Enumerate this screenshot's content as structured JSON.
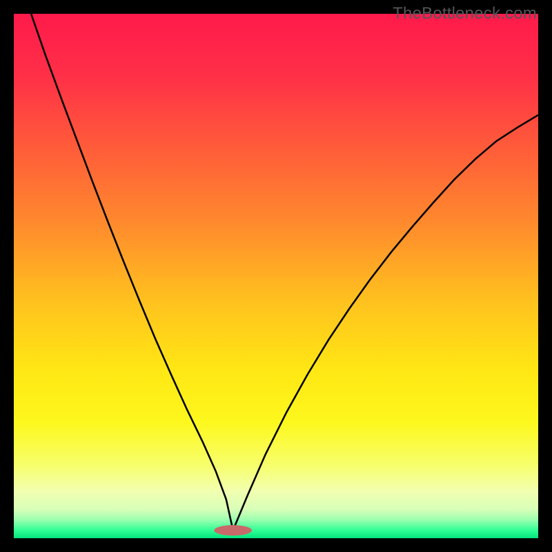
{
  "watermark": "TheBottleneck.com",
  "gradient_stops": [
    {
      "offset": 0.0,
      "color": "#ff1a4b"
    },
    {
      "offset": 0.12,
      "color": "#ff3047"
    },
    {
      "offset": 0.25,
      "color": "#ff5a3a"
    },
    {
      "offset": 0.4,
      "color": "#ff8a2d"
    },
    {
      "offset": 0.55,
      "color": "#ffc21e"
    },
    {
      "offset": 0.68,
      "color": "#ffe714"
    },
    {
      "offset": 0.78,
      "color": "#fdf81e"
    },
    {
      "offset": 0.86,
      "color": "#f7ff6a"
    },
    {
      "offset": 0.91,
      "color": "#f2ffb0"
    },
    {
      "offset": 0.945,
      "color": "#d8ffb8"
    },
    {
      "offset": 0.965,
      "color": "#9bffb0"
    },
    {
      "offset": 0.985,
      "color": "#2fff94"
    },
    {
      "offset": 1.0,
      "color": "#04e37f"
    }
  ],
  "marker": {
    "cx": 0.418,
    "cy": 0.985,
    "rx": 0.036,
    "ry": 0.01,
    "fill": "#c96a6a"
  },
  "chart_data": {
    "type": "line",
    "title": "",
    "xlabel": "",
    "ylabel": "",
    "xlim": [
      0,
      1
    ],
    "ylim": [
      0,
      1
    ],
    "series": [
      {
        "name": "left-branch",
        "x": [
          0.033,
          0.06,
          0.09,
          0.12,
          0.15,
          0.18,
          0.21,
          0.24,
          0.27,
          0.3,
          0.33,
          0.36,
          0.385,
          0.405,
          0.418
        ],
        "y": [
          1.0,
          0.922,
          0.84,
          0.76,
          0.68,
          0.602,
          0.526,
          0.452,
          0.38,
          0.312,
          0.246,
          0.184,
          0.128,
          0.074,
          0.015
        ]
      },
      {
        "name": "right-branch",
        "x": [
          0.418,
          0.445,
          0.48,
          0.52,
          0.56,
          0.6,
          0.64,
          0.68,
          0.72,
          0.76,
          0.8,
          0.84,
          0.88,
          0.92,
          0.96,
          1.0
        ],
        "y": [
          0.015,
          0.08,
          0.16,
          0.24,
          0.312,
          0.378,
          0.438,
          0.494,
          0.546,
          0.594,
          0.64,
          0.684,
          0.723,
          0.757,
          0.783,
          0.807
        ]
      }
    ]
  }
}
